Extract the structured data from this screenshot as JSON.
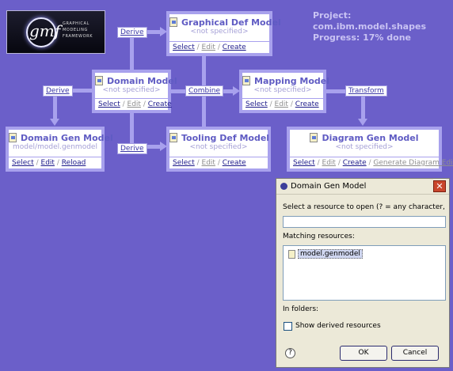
{
  "header": {
    "project_text": "Project: com.ibm.model.shapes",
    "progress_text": "Progress: 17% done",
    "logo_text": "GRAPHICAL MODELING FRAMEWORK",
    "logo_mark": "gmf"
  },
  "labels": {
    "derive_top": "Derive",
    "derive_left": "Derive",
    "derive_bottom": "Derive",
    "combine": "Combine",
    "transform": "Transform"
  },
  "nodes": {
    "graphical": {
      "title": "Graphical Def Model",
      "subtitle": "<not specified>",
      "actions": [
        "Select",
        "Edit",
        "Create"
      ]
    },
    "domain": {
      "title": "Domain Model",
      "subtitle": "<not specified>",
      "actions": [
        "Select",
        "Edit",
        "Create"
      ]
    },
    "mapping": {
      "title": "Mapping Model",
      "subtitle": "<not specified>",
      "actions": [
        "Select",
        "Edit",
        "Create"
      ]
    },
    "domain_gen": {
      "title": "Domain Gen Model",
      "subtitle": "model/model.genmodel",
      "actions": [
        "Select",
        "Edit",
        "Reload"
      ]
    },
    "tooling": {
      "title": "Tooling Def Model",
      "subtitle": "<not specified>",
      "actions": [
        "Select",
        "Edit",
        "Create"
      ]
    },
    "diagram_gen": {
      "title": "Diagram Gen Model",
      "subtitle": "<not specified>",
      "actions": [
        "Select",
        "Edit",
        "Create",
        "Generate Diagram Editor"
      ]
    }
  },
  "dialog": {
    "title": "Domain Gen Model",
    "close": "✕",
    "prompt": "Select a resource to open (? = any character, * = a",
    "search_value": "",
    "matching_label": "Matching resources:",
    "matches": [
      "model.genmodel"
    ],
    "folders_label": "In folders:",
    "show_derived_label": "Show derived resources",
    "help": "?",
    "ok": "OK",
    "cancel": "Cancel"
  },
  "colors": {
    "background": "#6b5fc9",
    "connector": "#a8a1ed",
    "title_text": "#5f5bc3"
  }
}
